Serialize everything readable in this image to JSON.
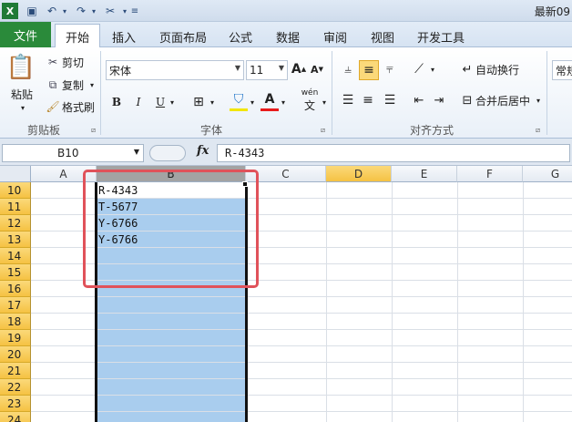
{
  "titlebar": {
    "qat_icons": [
      "excel-app-icon",
      "save-icon",
      "undo-icon",
      "redo-icon",
      "customize-icon"
    ],
    "title": "最新09"
  },
  "tabs": {
    "file": "文件",
    "items": [
      "开始",
      "插入",
      "页面布局",
      "公式",
      "数据",
      "审阅",
      "视图",
      "开发工具"
    ],
    "active": "开始"
  },
  "ribbon": {
    "clipboard": {
      "paste": "粘贴",
      "cut": "剪切",
      "copy": "复制",
      "format_painter": "格式刷",
      "group": "剪贴板"
    },
    "font": {
      "name": "宋体",
      "size": "11",
      "bold": "B",
      "italic": "I",
      "underline": "U",
      "phonetic": "wén",
      "group": "字体"
    },
    "alignment": {
      "wrap": "自动换行",
      "merge": "合并后居中",
      "group": "对齐方式"
    },
    "number": {
      "format": "常规"
    }
  },
  "formula_bar": {
    "name_box": "B10",
    "fx": "fx",
    "content": "R-4343"
  },
  "grid": {
    "columns": [
      "A",
      "B",
      "C",
      "D",
      "E",
      "F",
      "G"
    ],
    "selected_column": "B",
    "rows": [
      "10",
      "11",
      "12",
      "13",
      "14",
      "15",
      "16",
      "17",
      "18",
      "19",
      "20",
      "21",
      "22",
      "23",
      "24"
    ],
    "cells_b": [
      "R-4343",
      "T-5677",
      "Y-6766",
      "Y-6766"
    ]
  },
  "colors": {
    "file_tab": "#2a8a3a",
    "selection": "#a9cdee",
    "header_selected": "#f5c243",
    "highlight_box": "#e0525a"
  }
}
